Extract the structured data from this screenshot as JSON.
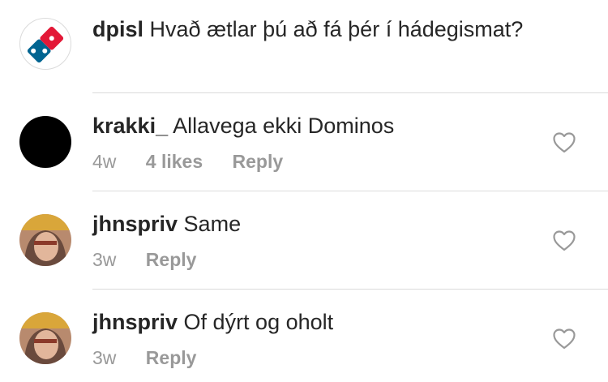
{
  "caption": {
    "username": "dpisl",
    "text": "Hvað ætlar þú að fá þér í hádegismat?",
    "avatar_icon": "dominos-logo-icon"
  },
  "comments": [
    {
      "username": "krakki_",
      "text": "Allavega ekki Dominos",
      "time": "4w",
      "likes": "4 likes",
      "reply": "Reply",
      "avatar_color": "#000000"
    },
    {
      "username": "jhnspriv",
      "text": "Same",
      "time": "3w",
      "reply": "Reply",
      "avatar_color": "#b8806a"
    },
    {
      "username": "jhnspriv",
      "text": "Of dýrt og oholt",
      "time": "3w",
      "reply": "Reply",
      "avatar_color": "#b8806a"
    }
  ],
  "colors": {
    "text": "#262626",
    "meta": "#999999",
    "divider": "#dbdbdb",
    "dominos_blue": "#006491",
    "dominos_red": "#e31837"
  }
}
